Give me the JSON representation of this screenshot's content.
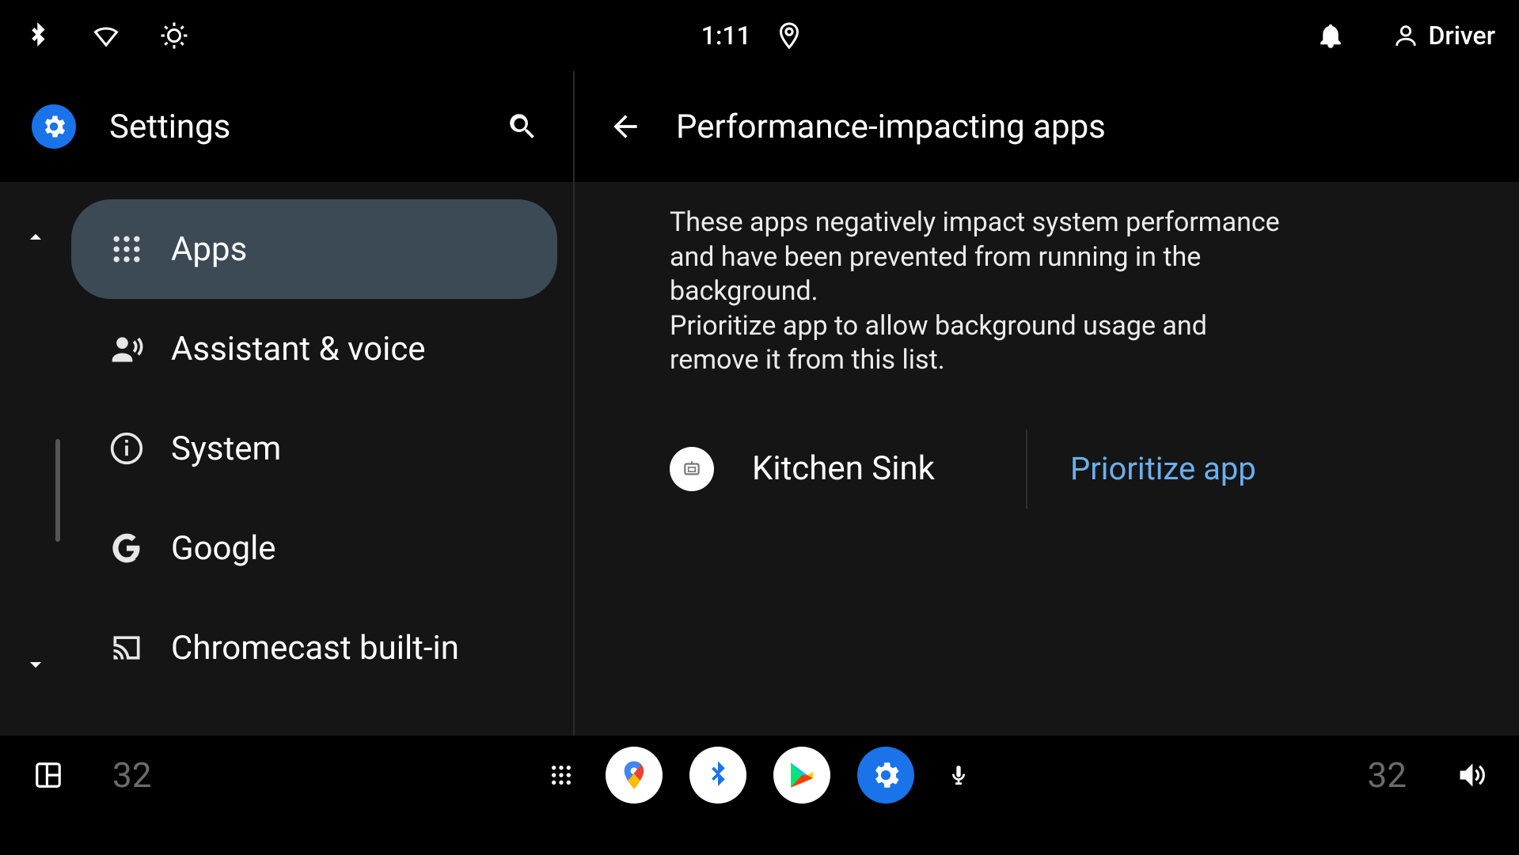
{
  "status_bar": {
    "time": "1:11",
    "user_label": "Driver"
  },
  "sidebar": {
    "title": "Settings",
    "items": [
      {
        "label": "Apps",
        "active": true
      },
      {
        "label": "Assistant & voice",
        "active": false
      },
      {
        "label": "System",
        "active": false
      },
      {
        "label": "Google",
        "active": false
      },
      {
        "label": "Chromecast built-in",
        "active": false
      }
    ]
  },
  "content": {
    "title": "Performance-impacting apps",
    "description_line1": "These apps negatively impact system performance and have been prevented from running in the background.",
    "description_line2": "Prioritize app to allow background usage and remove it from this list.",
    "apps": [
      {
        "name": "Kitchen Sink",
        "action_label": "Prioritize app"
      }
    ]
  },
  "dock": {
    "temperature_left": "32",
    "temperature_right": "32"
  },
  "colors": {
    "accent": "#1a73e8",
    "link": "#6ab0ee",
    "panel": "#151515",
    "active_item": "#3b4a55"
  }
}
